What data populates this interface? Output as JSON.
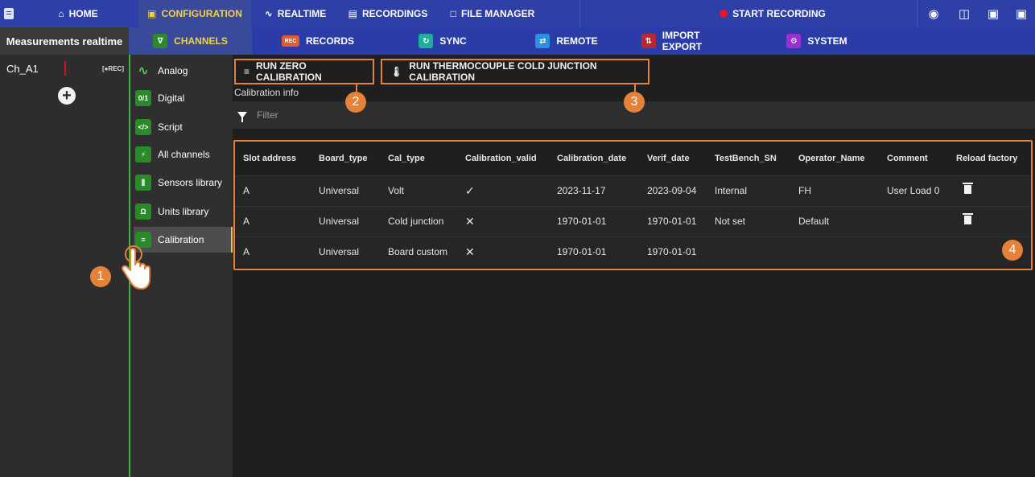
{
  "topbar": {
    "tabs": [
      {
        "label": "HOME",
        "icon": "home-icon"
      },
      {
        "label": "CONFIGURATION",
        "icon": "config-icon"
      },
      {
        "label": "REALTIME",
        "icon": "realtime-icon"
      },
      {
        "label": "RECORDINGS",
        "icon": "recordings-icon"
      },
      {
        "label": "FILE MANAGER",
        "icon": "folder-icon"
      }
    ],
    "start_recording": "START RECORDING",
    "icons": [
      "camera-icon",
      "book-icon",
      "lock-icon",
      "lock-icon"
    ]
  },
  "subbar": {
    "panel_title": "Measurements realtime",
    "tabs": [
      {
        "label": "CHANNELS"
      },
      {
        "label": "RECORDS"
      },
      {
        "label": "SYNC"
      },
      {
        "label": "REMOTE"
      },
      {
        "label": "IMPORT EXPORT"
      },
      {
        "label": "SYSTEM"
      }
    ]
  },
  "channels": {
    "items": [
      {
        "name": "Ch_A1",
        "rec": "[●REC]"
      }
    ]
  },
  "nav": {
    "items": [
      {
        "label": "Analog",
        "icon": "∿"
      },
      {
        "label": "Digital",
        "icon": "0/1"
      },
      {
        "label": "Script",
        "icon": "</>"
      },
      {
        "label": "All channels",
        "icon": "⚡"
      },
      {
        "label": "Sensors library",
        "icon": "⫼"
      },
      {
        "label": "Units library",
        "icon": "Ω"
      },
      {
        "label": "Calibration",
        "icon": "≡"
      }
    ]
  },
  "main": {
    "zero_cal_button": "RUN ZERO CALIBRATION",
    "thermo_cal_button": "RUN THERMOCOUPLE COLD JUNCTION CALIBRATION",
    "cal_info_label": "Calibration info",
    "filter_placeholder": "Filter",
    "table": {
      "columns": [
        "Slot address",
        "Board_type",
        "Cal_type",
        "Calibration_valid",
        "Calibration_date",
        "Verif_date",
        "TestBench_SN",
        "Operator_Name",
        "Comment",
        "Reload factory"
      ],
      "rows": [
        {
          "slot": "A",
          "board": "Universal",
          "cal": "Volt",
          "valid": "✓",
          "cal_date": "2023-11-17",
          "verif_date": "2023-09-04",
          "bench": "Internal",
          "operator": "FH",
          "comment": "User Load 0"
        },
        {
          "slot": "A",
          "board": "Universal",
          "cal": "Cold junction",
          "valid": "✕",
          "cal_date": "1970-01-01",
          "verif_date": "1970-01-01",
          "bench": "Not set",
          "operator": "Default",
          "comment": ""
        },
        {
          "slot": "A",
          "board": "Universal",
          "cal": "Board custom",
          "valid": "✕",
          "cal_date": "1970-01-01",
          "verif_date": "1970-01-01",
          "bench": "",
          "operator": "",
          "comment": ""
        }
      ]
    }
  },
  "callouts": [
    "1",
    "2",
    "3",
    "4"
  ],
  "colors": {
    "accent": "#e4823a",
    "topbar": "#2e3fa8",
    "active_tab_text": "#f4d23b",
    "nav_green": "#3fb23f"
  }
}
